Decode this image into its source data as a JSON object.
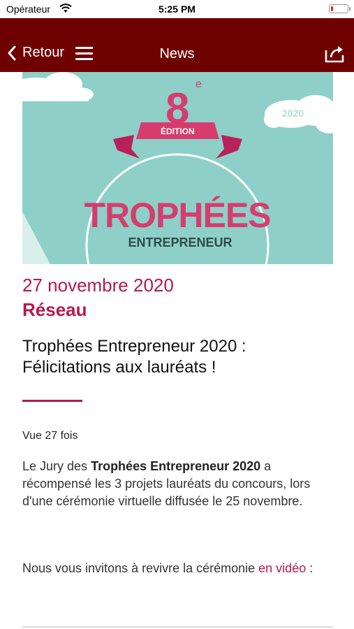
{
  "status_bar": {
    "carrier": "Opérateur",
    "time": "5:25 PM"
  },
  "nav": {
    "back_label": "Retour",
    "title": "News"
  },
  "hero": {
    "edition_number": "8",
    "edition_suffix": "e",
    "edition_label": "ÉDITION",
    "trophy_word": "TROPHÉES",
    "subtitle": "ENTREPRENEUR",
    "year": "2020"
  },
  "article": {
    "date": "27 novembre 2020",
    "category": "Réseau",
    "title": "Trophées Entrepreneur 2020 : Félicitations aux lauréats !",
    "views": "Vue 27 fois",
    "p1_prefix": "Le Jury des ",
    "p1_bold": "Trophées Entrepreneur 2020",
    "p1_suffix": " a récompensé les 3 projets lauréats du concours, lors d'une cérémonie virtuelle diffusée le 25 novembre.",
    "p2_prefix": "Nous vous invitons à revivre la cérémonie ",
    "p2_link": "en vidéo",
    "p2_suffix": " :"
  },
  "colors": {
    "nav_background": "#6f0000",
    "accent": "#b8174f",
    "hero_background": "#8ed0c7"
  },
  "icons": [
    "wifi-icon",
    "battery-icon",
    "chevron-left-icon",
    "menu-icon",
    "share-icon"
  ]
}
